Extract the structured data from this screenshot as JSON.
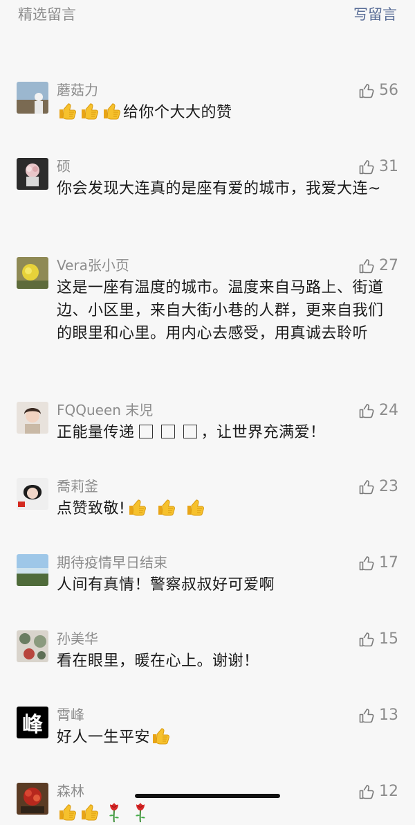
{
  "header": {
    "title": "精选留言",
    "write": "写留言"
  },
  "comments": [
    {
      "name": "蘑菇力",
      "likes": "56",
      "text": "给你个大大的赞"
    },
    {
      "name": "硕",
      "likes": "31",
      "text": "你会发现大连真的是座有爱的城市，我爱大连~"
    },
    {
      "name": "Vera张小页",
      "likes": "27",
      "text": "这是一座有温度的城市。温度来自马路上、街道边、小区里，来自大街小巷的人群，更来自我们的眼里和心里。用内心去感受，用真诚去聆听"
    },
    {
      "name": "FQQueen 末児",
      "likes": "24",
      "text_a": "正能量传递",
      "text_b": "，让世界充满爱！"
    },
    {
      "name": "喬莉釜",
      "likes": "23",
      "text": "点赞致敬!"
    },
    {
      "name": "期待疫情早日结束",
      "likes": "17",
      "text": "人间有真情！警察叔叔好可爱啊"
    },
    {
      "name": "孙美华",
      "likes": "15",
      "text": "看在眼里，暖在心上。谢谢！"
    },
    {
      "name": "霄峰",
      "likes": "13",
      "text": "好人一生平安",
      "avatar_char": "峰"
    },
    {
      "name": "森林",
      "likes": "12",
      "text": ""
    }
  ]
}
